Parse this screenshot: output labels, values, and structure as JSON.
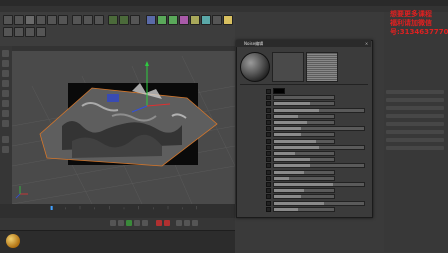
{
  "window": {
    "title": ""
  },
  "menu": {
    "items": [
      "",
      "",
      "",
      "",
      "",
      "",
      "",
      "",
      "",
      "",
      ""
    ]
  },
  "dialog": {
    "title": "Noise编辑",
    "close_glyph": "×",
    "properties": [
      {
        "label": "",
        "value": "",
        "fill": 0.0
      },
      {
        "label": "",
        "value": "",
        "fill": 0.0
      },
      {
        "label": "",
        "value": "",
        "fill": 0.6
      },
      {
        "label": "",
        "value": "",
        "fill": 0.5
      },
      {
        "label": "",
        "value": "",
        "fill": 0.4
      },
      {
        "label": "",
        "value": "",
        "fill": 0.55
      },
      {
        "label": "",
        "value": "",
        "fill": 0.3
      },
      {
        "label": "",
        "value": "",
        "fill": 0.45
      },
      {
        "label": "",
        "value": "",
        "fill": 0.7
      },
      {
        "label": "",
        "value": "",
        "fill": 0.5
      },
      {
        "label": "",
        "value": "",
        "fill": 0.35
      },
      {
        "label": "",
        "value": "",
        "fill": 0.6
      },
      {
        "label": "",
        "value": "",
        "fill": 0.4
      },
      {
        "label": "",
        "value": "",
        "fill": 0.5
      },
      {
        "label": "",
        "value": "",
        "fill": 0.25
      },
      {
        "label": "",
        "value": "",
        "fill": 0.65
      },
      {
        "label": "",
        "value": "",
        "fill": 0.5
      },
      {
        "label": "",
        "value": "",
        "fill": 0.45
      },
      {
        "label": "",
        "value": "",
        "fill": 0.55
      },
      {
        "label": "",
        "value": "",
        "fill": 0.4
      }
    ]
  },
  "watermark": {
    "line1": "想要更多课程",
    "line2": "福利请加微信",
    "line3": "号:3134637770"
  },
  "colors": {
    "watermark": "#e02020",
    "viewport_bg": "#4a4a4a",
    "dialog_bg": "#3b3b3b",
    "terrain_frame": "#d4762a"
  }
}
